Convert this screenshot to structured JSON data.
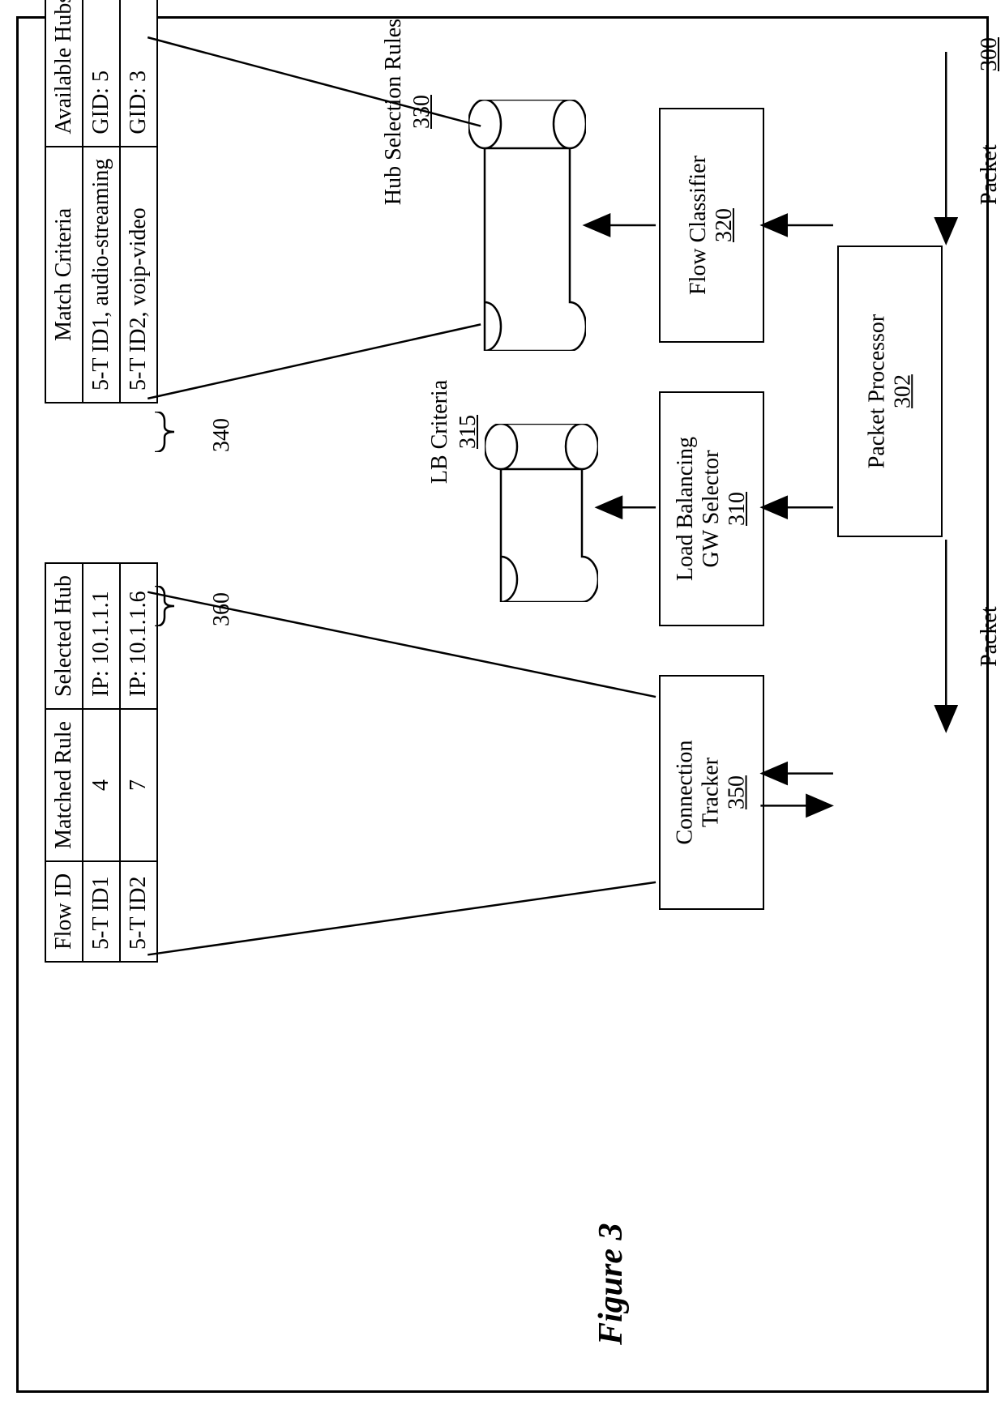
{
  "figure_label": "Figure 3",
  "diagram_id": "300",
  "packet_in": "Packet",
  "packet_out": "Packet",
  "boxes": {
    "packet_processor": {
      "label": "Packet Processor",
      "ref": "302"
    },
    "flow_classifier": {
      "label": "Flow Classifier",
      "ref": "320"
    },
    "gw_selector_line1": "Load Balancing",
    "gw_selector_line2": "GW Selector",
    "gw_selector_ref": "310",
    "conn_tracker_line1": "Connection",
    "conn_tracker_line2": "Tracker",
    "conn_tracker_ref": "350"
  },
  "cylinders": {
    "hub_rules": {
      "label": "Hub Selection Rules",
      "ref": "330"
    },
    "lb_criteria": {
      "label": "LB Criteria",
      "ref": "315"
    }
  },
  "table340_ref": "340",
  "table340": {
    "headers": [
      "Match Criteria",
      "Available Hubs"
    ],
    "rows": [
      [
        "5-T ID1, audio-streaming",
        "GID: 5"
      ],
      [
        "5-T ID2, voip-video",
        "GID: 3"
      ]
    ]
  },
  "table360_ref": "360",
  "table360": {
    "headers": [
      "Flow ID",
      "Matched Rule",
      "Selected Hub"
    ],
    "rows": [
      [
        "5-T ID1",
        "4",
        "IP: 10.1.1.1"
      ],
      [
        "5-T ID2",
        "7",
        "IP: 10.1.1.6"
      ]
    ]
  }
}
